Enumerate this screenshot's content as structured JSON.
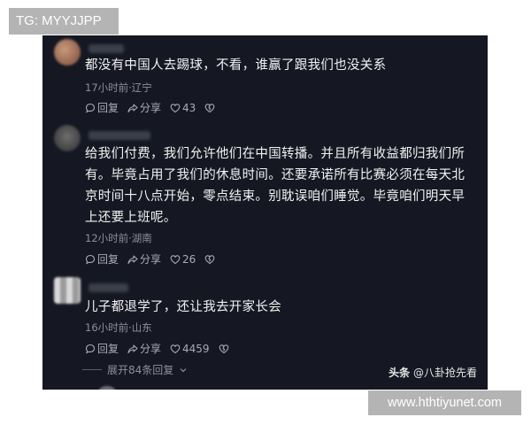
{
  "watermark_tag": "TG: MYYJJPP",
  "site_watermark": "www.hthtiyunet.com",
  "comments": [
    {
      "text": "都没有中国人去踢球，不看，谁赢了跟我们也没关系",
      "meta": "17小时前·辽宁",
      "reply_label": "回复",
      "share_label": "分享",
      "likes": "43"
    },
    {
      "text": "给我们付费，我们允许他们在中国转播。并且所有收益都归我们所有。毕竟占用了我们的休息时间。还要承诺所有比赛必须在每天北京时间十八点开始，零点结束。别耽误咱们睡觉。毕竟咱们明天早上还要上班呢。",
      "meta": "12小时前·湖南",
      "reply_label": "回复",
      "share_label": "分享",
      "likes": "26"
    },
    {
      "text": "儿子都退学了，还让我去开家长会",
      "meta": "16小时前·山东",
      "reply_label": "回复",
      "share_label": "分享",
      "likes": "4459"
    }
  ],
  "expand_replies": "展开84条回复",
  "source": {
    "platform": "头条",
    "account": "@八卦抢先看"
  }
}
